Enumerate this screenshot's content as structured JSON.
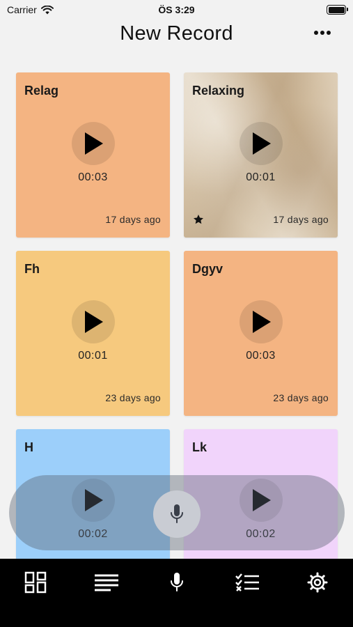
{
  "status_bar": {
    "carrier": "Carrier",
    "time": "ÖS 3:29"
  },
  "header": {
    "title": "New Record",
    "more_icon": "more-horizontal-icon"
  },
  "cards": [
    {
      "title": "Relag",
      "duration": "00:03",
      "ago": "17 days ago",
      "color": "#f4b482",
      "favorite": false
    },
    {
      "title": "Relaxing",
      "duration": "00:01",
      "ago": "17 days ago",
      "background": "marble-texture",
      "favorite": true
    },
    {
      "title": "Fh",
      "duration": "00:01",
      "ago": "23 days ago",
      "color": "#f6c97e",
      "favorite": false
    },
    {
      "title": "Dgyv",
      "duration": "00:03",
      "ago": "23 days ago",
      "color": "#f4b482",
      "favorite": false
    },
    {
      "title": "H",
      "duration": "00:02",
      "color": "#9ccffa",
      "favorite": false
    },
    {
      "title": "Lk",
      "duration": "00:02",
      "color": "#f1d4fb",
      "favorite": false
    }
  ],
  "record_button": {
    "icon": "microphone-icon"
  },
  "tab_bar": [
    {
      "name": "grid",
      "icon": "grid-icon"
    },
    {
      "name": "list",
      "icon": "list-icon"
    },
    {
      "name": "record",
      "icon": "microphone-icon"
    },
    {
      "name": "checklist",
      "icon": "checklist-icon"
    },
    {
      "name": "settings",
      "icon": "gear-icon"
    }
  ]
}
